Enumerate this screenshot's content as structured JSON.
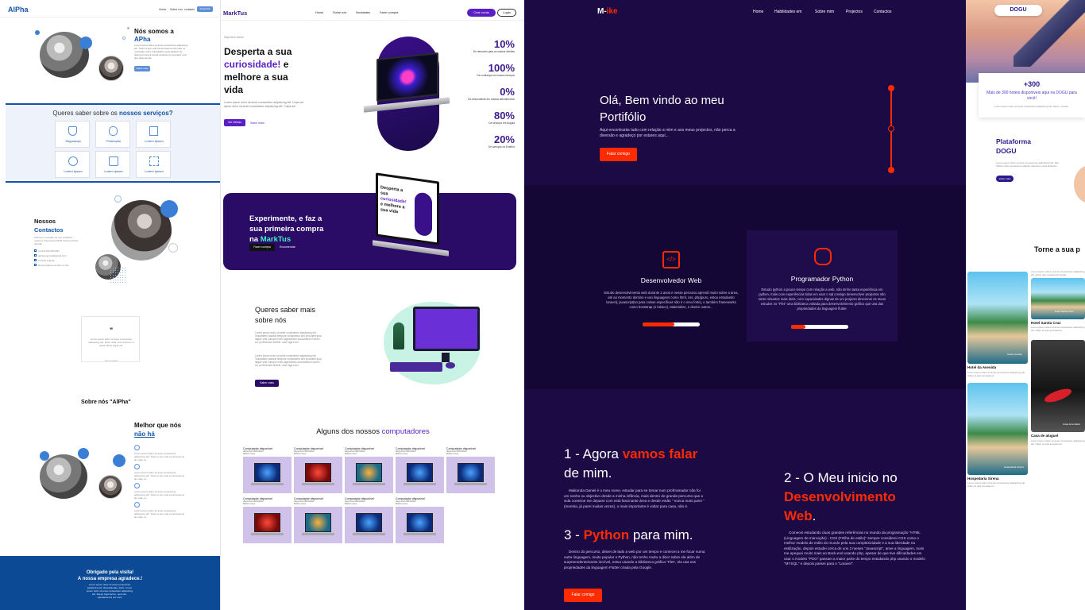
{
  "p1": {
    "logo": "AlPha",
    "nav": [
      "Home",
      "Sobre nos",
      "contacto"
    ],
    "nav_cta": "Subscribir",
    "hero_title_1": "Nós somos a",
    "hero_title_2": "APha",
    "hero_text": "Lorem ipsum dolor sit amet consectetur adipisicing elit. Totam a quo velit ea accusamus ab nulla, ex molestiae nobis voluptatibus optio adipisci hic deleniti tempora soluta voluptas consequatur eius quo assumenda.",
    "hero_btn": "Saber mais",
    "services_title_1": "Queres saber sobre os ",
    "services_title_2": "nossos serviços?",
    "services": [
      "Segurança",
      "Protecção",
      "Lorem Ipsum",
      "Lorem Ipsum",
      "Lorem Ipsum",
      "Lorem Ipsum"
    ],
    "contacts_title_1": "Nossos",
    "contacts_title_2": "Contactos",
    "contacts_text": "Sinta-se a vontade de nos contactar, estamos disponiveis 24/24 horas para lhe atender",
    "contacts": [
      "(+244) 922 000 000",
      "alphaempresa@gmail.com",
      "Luanda,Angola",
      "Nossa pagina na web no site"
    ],
    "quote_mark": "❝",
    "quote_text": "Lorem ipsum dolor sit amet consectetur adipisicing elit. Dolor nulla, vero dolorum ut quasi officiis fugiat qui.",
    "quote_author": "Nome fixado",
    "about_title": "Sobre nós \"AlPha\"",
    "better_1": "Melhor que nós",
    "better_2": "não há",
    "better_items": [
      "Lorem ipsum dolor sit amet consectetur adipisicing elit. Totam a quo velit ea accusamus ab nulla, ex.",
      "Lorem ipsum dolor sit amet consectetur adipisicing elit. Totam a quo velit ea accusamus ab nulla, ex.",
      "Lorem ipsum dolor sit amet consectetur adipisicing elit. Totam a quo velit ea accusamus ab nulla, ex.",
      "Lorem ipsum dolor sit amet consectetur adipisicing elit. Totam a quo velit ea accusamus ab nulla, ex."
    ],
    "footer_1": "Obrigado pela visita!",
    "footer_2": "A nossa empresa agradece.!",
    "footer_text": "Lorem ipsum dolor sit amet consectetur adipisicing elit. Repudiandae, dolor. Lorem ipsum dolor sit amet consectetur adipisicing elit. Saepe fuga harum, quis iure. Agradecemos por você"
  },
  "p2": {
    "logo": "MarkTus",
    "nav": [
      "Home",
      "Sobre nós",
      "Novidades",
      "Fazer compra"
    ],
    "cta": "Criar conta",
    "login": "Login",
    "eyebrow": "Seja bem vindo!",
    "title_1": "Desperta a sua",
    "title_2": "curiosidade!",
    "title_3": " e",
    "title_4": "melhore a sua",
    "title_5": "vida",
    "hero_text": "Lorem ipsum dolor sit amet consectetur adipisicing elit. Culpa ad ipsum dolor sit amet consectetur adipisicing elit. Culpa ad!",
    "btn1": "Ver ofertas",
    "btn2": "Saber mais",
    "stats": [
      {
        "v": "10%",
        "l": "De desconto para os nossos clientes"
      },
      {
        "v": "100%",
        "l": "De confiança em nossos serviços"
      },
      {
        "v": "0%",
        "l": "De descontente em nossos atendimentos"
      },
      {
        "v": "80%",
        "l": "De serviços em Angola"
      },
      {
        "v": "20%",
        "l": "De serviços no Exterior"
      }
    ],
    "promo_1": "Experimente, e faz a",
    "promo_2": "sua primeira compra",
    "promo_3": "na ",
    "promo_4": "MarkTus",
    "promo_btn1": "Fazer compra",
    "promo_btn2": "Encomendar",
    "mini_title_1": "Desperta a",
    "mini_title_2": "sua",
    "mini_title_3": "curiosidade!",
    "mini_title_4": "e melhore a",
    "mini_title_5": "sua vida",
    "about_title_1": "Queres saber mais",
    "about_title_2": "sobre nós",
    "about_text": "Lorem ipsum dolor sit amet consectetur adipisicing elit. Voluptatem placeat tempore consectetur sint provident ipsa itaque velit cumque enim dignissimos accusantium harum ea, perferendis deleniti, odio fuga error.",
    "about_text2": "Lorem ipsum dolor sit amet consectetur adipisicing elit. Voluptatem placeat tempore consectetur sint provident ipsa itaque velit cumque enim dignissimos accusantium harum ea, perferendis deleniti, odio fuga error.",
    "about_btn": "Saber mais",
    "products_title_1": "Alguns dos nossos ",
    "products_title_2": "computadores",
    "product_name": "Computador disponível",
    "product_sub": "disponível:28/10/2022",
    "product_price": "Melhor preço",
    "products_row1": 5,
    "products_row2": 4
  },
  "p3": {
    "logo_1": "M-",
    "logo_2": "ike",
    "nav": [
      "Home",
      "Habilidades em",
      "Sobre mim",
      "Projectos",
      "Contactos"
    ],
    "hero_1": "Olá, Bem vindo ao meu",
    "hero_2": "Portifólio",
    "hero_text": "Aqui encontrarás tudo com relação a mim e aos meus projectos, não perca a diversão e agradeço por estares aqui...",
    "hero_btn": "Falar comigo",
    "skills": [
      {
        "title": "Desenvolvedor Web",
        "text": "Estudo desenvolvimento web durante 2 anos e nesse percurso aprendi muito sobre a área, até ao momento domino e uso linguagens como html, css, php(puro, estou estudando laravel), javascript(so para coisas específicas não é o meu forte), e também frameworks como bootstrap (o básico), Materialize, e dentre outros...",
        "level": 0.55
      },
      {
        "title": "Programador Python",
        "text": "Estudo python a pouco tempo com relação a web, não tenho tanta experiência em python, mais com experiências tidas em usar o sql consigo desenvolver projectos não tanto robustos mais úteis, com capacidades dignas de um projecto direcionei os meus estudos no \"Flet\" uma biblioteca voltada para desenvolvimento gráfico que usa das propriedades da linguagem flutter.",
        "level": 0.25
      }
    ],
    "s1_a": "1 - Agora ",
    "s1_b": "vamos falar",
    "s1_c": "de mim.",
    "s1_text": "Maikonda Daniel é o meu nome, estudar para se tornar num profrramador não foi um sonho ou objectivo desde a minha infância, mais dentro do grande percurso que a vida constroe me deparei com está fascinante área e desde então \" nunca mais parei \" (mentira, já parei muitas vezes), o mais importante é voltar para casa, não é.",
    "s2_a": "2 - O Meu inicio no",
    "s2_b": "Desenvolvimento",
    "s2_c": "Web",
    "s2_d": ".",
    "s2_text": "Comecei estudando duas grandes referências no mundo da programação \"HTML (Linguagem de marcação) - CSS (FOlha de estilo)\" sempre considerei CSS como o melhor modelo de estilo do mundo pela sua complexividade e a sua liberdade na estilização, depois estudei cerca de uns 2 meses \"Javascript\", amei a linguagem, mais me apeguei muito mais ao Back-end usando php, apesar de que tive dificuldades em usar o modelo \"PDO\" passaei a maior parte do tempo estudando php usando o modelo \"MYSQL\" e depois passei para o \"Laravel\".",
    "s3_a": "3 - ",
    "s3_b": "Python",
    "s3_c": " para mim.",
    "s3_text": "Dentro do percurso, deixei de lado a web por um tempo e comecei a me focar numa outra linguagem, muito popular o Python, não tenho muito a dizer sobre ela além de surpreendentemente incrível, estou usando a biblioteca gráfica \"Flet\", ela usa oss propriedades da linguagem Flutter criada pela Google.",
    "s3_btn": "Falar comigo",
    "accent": "#ff2a00"
  },
  "p4": {
    "logo": "DOGU",
    "count": "+300",
    "count_text": "Mais de 300 hoteis disponiveis aqui na DOGU para você!",
    "count_sub": "Lorem ipsum dolor sit amet consectetur adipisicing elit. Nemo, veniam.",
    "title_1": "Plataforma",
    "title_2": "DOGU",
    "text": "Lorem ipsum dolor sit amet consectetur adipisicing elit. Nisi. Officia nobis accusamus adipisci deleniti ex quia distinctio.",
    "btn": "saber mais",
    "section": "Torne a sua p",
    "section_sub": "Lorem ipsum dolor sit amet consectetur adipisicing elit. Atque quis repellendus fugiat.",
    "hotels": [
      {
        "name": "Hotel da Avenida",
        "tag": "Hotel Avenida"
      },
      {
        "name": "Hotel Santta Cruz",
        "tag": "Hotel Santta Cruz"
      },
      {
        "name": "Casa de aluguel",
        "tag": "Casa Arrendada"
      },
      {
        "name": "Hospedaria Sirena",
        "tag": "Hospedaria Sirena"
      }
    ],
    "hotel_desc": "Lorem ipsum dolor sit amet consectetur adipisicing elit. Ullam at quis accusamus."
  }
}
